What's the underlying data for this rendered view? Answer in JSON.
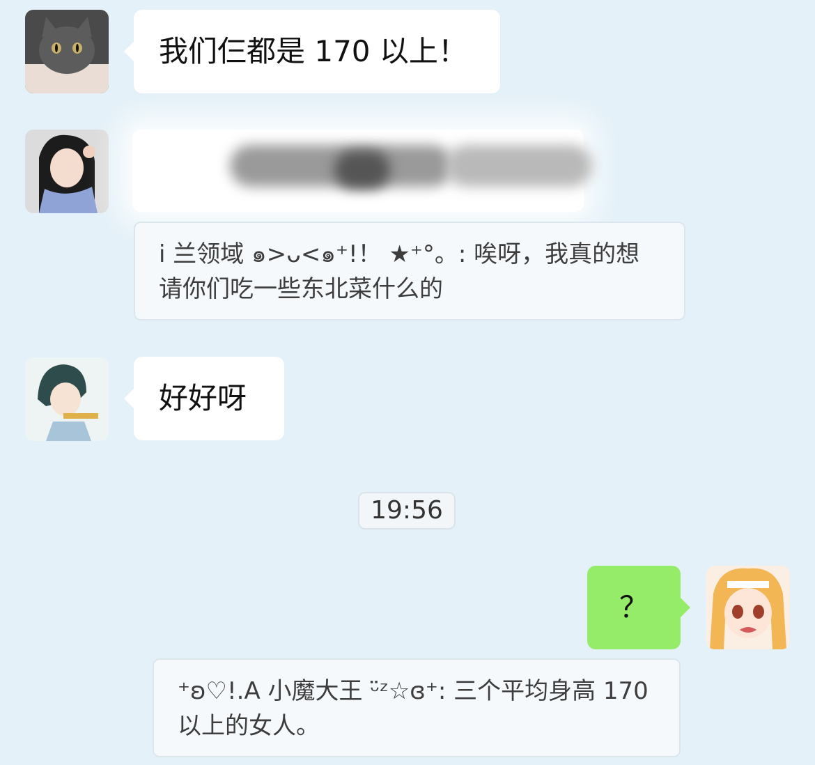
{
  "messages": [
    {
      "text": "我们仨都是 170 以上！"
    },
    {
      "text": ""
    },
    {
      "text": "好好呀"
    },
    {
      "text": "？"
    }
  ],
  "quotes": [
    {
      "text": "i 兰领域 ๑>ᴗ<๑⁺!！ ★⁺°。: 唉呀，我真的想请你们吃一些东北菜什么的"
    },
    {
      "text": "⁺ʚ♡!.A 小魔大王 ᵕ̈ᶻ☆ɞ⁺: 三个平均身高 170 以上的女人。"
    }
  ],
  "timestamp": "19:56",
  "colors": {
    "background": "#e4f1f8",
    "bubble_left": "#ffffff",
    "bubble_right": "#95ec69",
    "quote_bg": "#f5f9fc"
  },
  "icons": {
    "avatar_1": "cat-avatar-icon",
    "avatar_2": "girl-scarf-avatar-icon",
    "avatar_3": "anime-girl-avatar-icon",
    "avatar_self": "anime-blonde-girl-avatar-icon"
  }
}
